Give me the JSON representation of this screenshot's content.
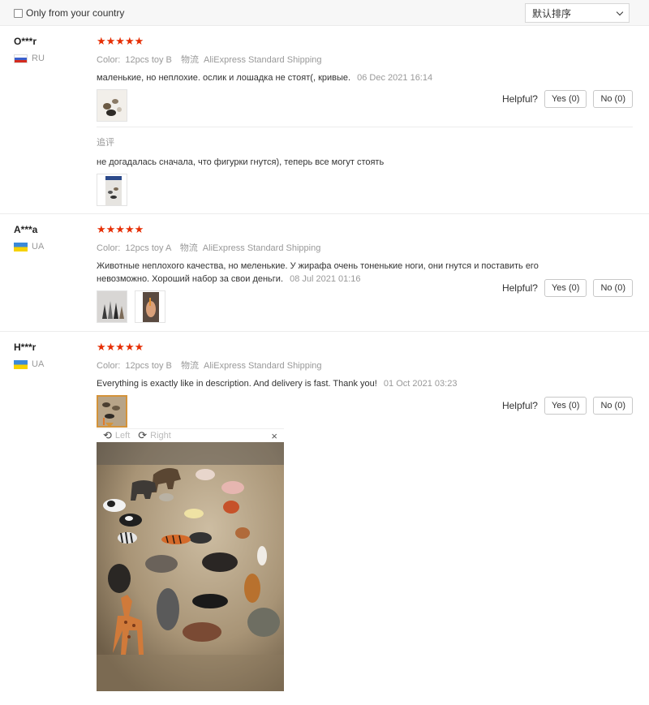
{
  "filters": {
    "only_country_label": "Only from your country",
    "sort_value": "默认排序"
  },
  "colors": {
    "star": "#e62e04",
    "border": "#ececec"
  },
  "reviews": [
    {
      "user": "O***r",
      "country": "RU",
      "stars": "★★★★★",
      "color_label": "Color:",
      "color_value": "12pcs toy B",
      "shipping_label": "物流",
      "shipping_value": "AliExpress Standard Shipping",
      "text": "маленькие, но неплохие. ослик и лошадка не стоят(, кривые.",
      "date": "06 Dec 2021 16:14",
      "followup_label": "追评",
      "followup_text": "не догадалась сначала, что фигурки гнутся), теперь все могут стоять"
    },
    {
      "user": "A***a",
      "country": "UA",
      "stars": "★★★★★",
      "color_label": "Color:",
      "color_value": "12pcs toy A",
      "shipping_label": "物流",
      "shipping_value": "AliExpress Standard Shipping",
      "text": "Животные неплохого качества, но меленькие. У жирафа очень тоненькие ноги, они гнутся и поставить его невозможно. Хороший набор за свои деньги.",
      "date": "08 Jul 2021 01:16"
    },
    {
      "user": "H***r",
      "country": "UA",
      "stars": "★★★★★",
      "color_label": "Color:",
      "color_value": "12pcs toy B",
      "shipping_label": "物流",
      "shipping_value": "AliExpress Standard Shipping",
      "text": "Everything is exactly like in description. And delivery is fast. Thank you!",
      "date": "01 Oct 2021 03:23"
    }
  ],
  "helpful": {
    "label": "Helpful?",
    "yes": "Yes (0)",
    "no": "No (0)"
  },
  "viewer": {
    "rotate_left": "Left",
    "rotate_right": "Right",
    "close_icon": "×"
  }
}
